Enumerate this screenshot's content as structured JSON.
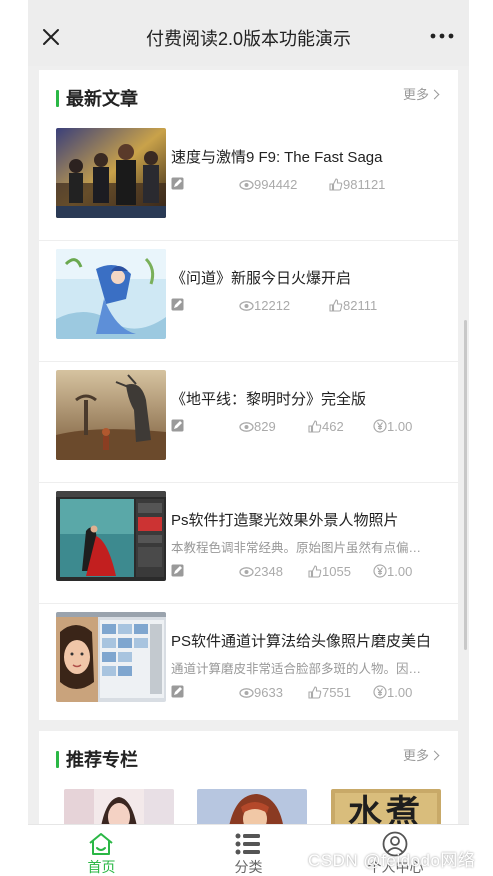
{
  "header": {
    "title": "付费阅读2.0版本功能演示",
    "close_icon": "close-icon",
    "more_icon": "more-dots-icon"
  },
  "latest": {
    "title": "最新文章",
    "more_label": "更多",
    "items": [
      {
        "title": "速度与激情9 F9: The Fast Saga",
        "description": "",
        "views": "994442",
        "likes": "981121",
        "price": ""
      },
      {
        "title": "《问道》新服今日火爆开启",
        "description": "",
        "views": "12212",
        "likes": "82111",
        "price": ""
      },
      {
        "title": "《地平线：黎明时分》完全版",
        "description": "",
        "views": "829",
        "likes": "462",
        "price": "1.00"
      },
      {
        "title": "Ps软件打造聚光效果外景人物照片",
        "description": "本教程色调非常经典。原始图片虽然有点偏…",
        "views": "2348",
        "likes": "1055",
        "price": "1.00"
      },
      {
        "title": "PS软件通道计算法给头像照片磨皮美白",
        "description": "通道计算磨皮非常适合脸部多斑的人物。因…",
        "views": "9633",
        "likes": "7551",
        "price": "1.00"
      }
    ]
  },
  "recommended": {
    "title": "推荐专栏",
    "more_label": "更多",
    "thumb_text": "水煮"
  },
  "tabbar": {
    "tabs": [
      {
        "label": "首页",
        "icon": "home-icon",
        "active": true
      },
      {
        "label": "分类",
        "icon": "list-icon",
        "active": false
      },
      {
        "label": "个人中心",
        "icon": "user-icon",
        "active": false
      }
    ]
  },
  "watermark": "CSDN @feidodo网络",
  "colors": {
    "accent": "#2ab745",
    "muted": "#aaaaaa",
    "background": "#efefef"
  }
}
